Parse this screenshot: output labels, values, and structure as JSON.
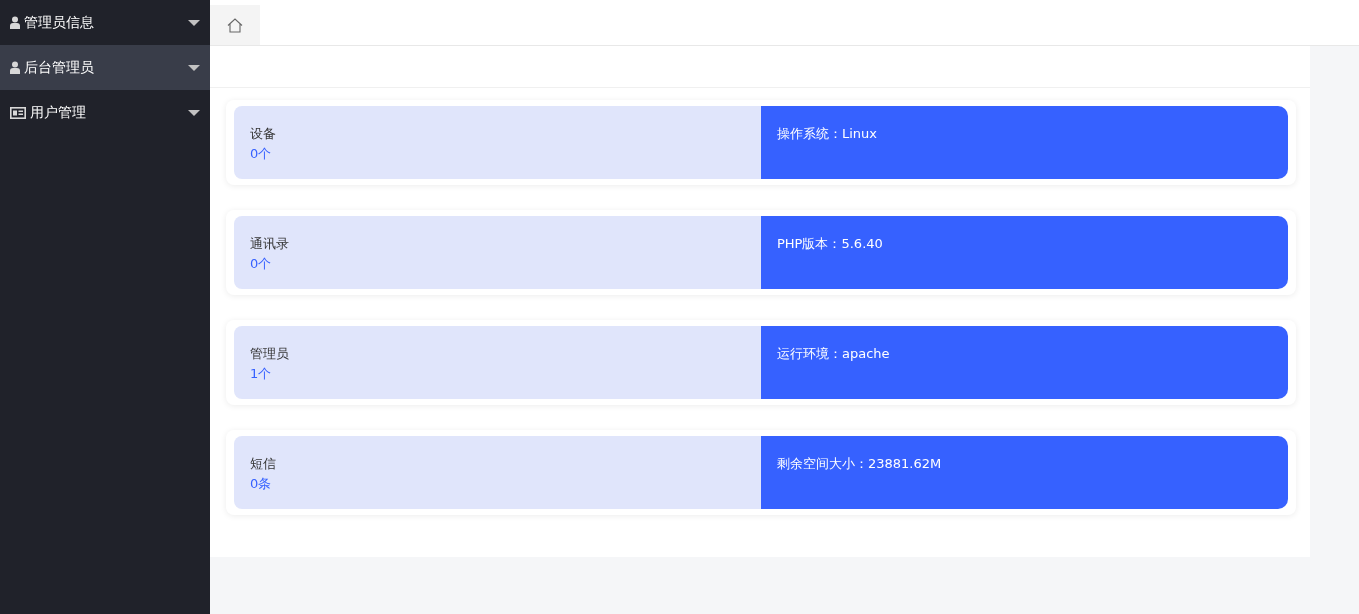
{
  "sidebar": {
    "items": [
      {
        "label": "管理员信息",
        "kind": "person",
        "selected": false,
        "expanded": false
      },
      {
        "label": "后台管理员",
        "kind": "person",
        "selected": true,
        "expanded": false
      },
      {
        "label": "用户管理",
        "kind": "card",
        "selected": false,
        "expanded": false
      }
    ]
  },
  "stats": [
    {
      "label": "设备",
      "count": "0个",
      "info": "操作系统：Linux"
    },
    {
      "label": "通讯录",
      "count": "0个",
      "info": "PHP版本：5.6.40"
    },
    {
      "label": "管理员",
      "count": "1个",
      "info": "运行环境：apache"
    },
    {
      "label": "短信",
      "count": "0条",
      "info": "剩余空间大小：23881.62M"
    }
  ]
}
